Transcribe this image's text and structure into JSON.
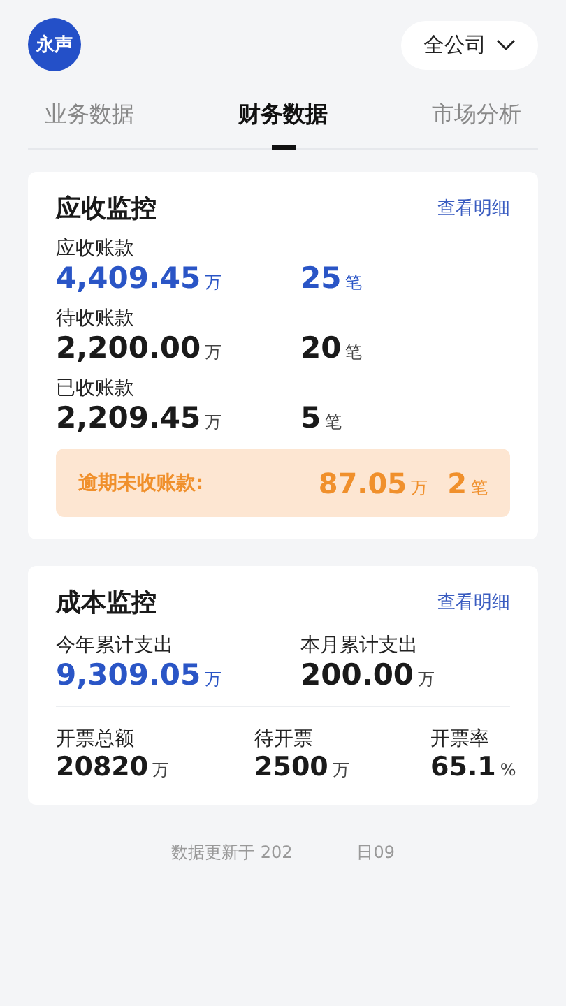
{
  "header": {
    "avatar": "永声",
    "company_select": "全公司"
  },
  "tabs": [
    {
      "label": "业务数据",
      "selected": false
    },
    {
      "label": "财务数据",
      "selected": true
    },
    {
      "label": "市场分析",
      "selected": false
    }
  ],
  "receivables": {
    "title": "应收监控",
    "link": "查看明细",
    "rows": [
      {
        "label": "应收账款",
        "amount": "4,409.45",
        "unit": "万",
        "count": "25",
        "count_unit": "笔",
        "highlight": true
      },
      {
        "label": "待收账款",
        "amount": "2,200.00",
        "unit": "万",
        "count": "20",
        "count_unit": "笔",
        "highlight": false
      },
      {
        "label": "已收账款",
        "amount": "2,209.45",
        "unit": "万",
        "count": "5",
        "count_unit": "笔",
        "highlight": false
      }
    ],
    "overdue": {
      "label": "逾期未收账款:",
      "amount": "87.05",
      "unit": "万",
      "count": "2",
      "count_unit": "笔"
    }
  },
  "cost": {
    "title": "成本监控",
    "link": "查看明细",
    "top": [
      {
        "label": "今年累计支出",
        "value": "9,309.05",
        "unit": "万",
        "highlight": true
      },
      {
        "label": "本月累计支出",
        "value": "200.00",
        "unit": "万",
        "highlight": false
      }
    ],
    "bottom": [
      {
        "label": "开票总额",
        "value": "20820",
        "unit": "万",
        "highlight": false
      },
      {
        "label": "待开票",
        "value": "2500",
        "unit": "万",
        "highlight": false
      },
      {
        "label": "开票率",
        "value": "65.1",
        "unit": "%",
        "highlight": false
      }
    ]
  },
  "footer": [
    "数据更新于 202",
    "日09"
  ]
}
